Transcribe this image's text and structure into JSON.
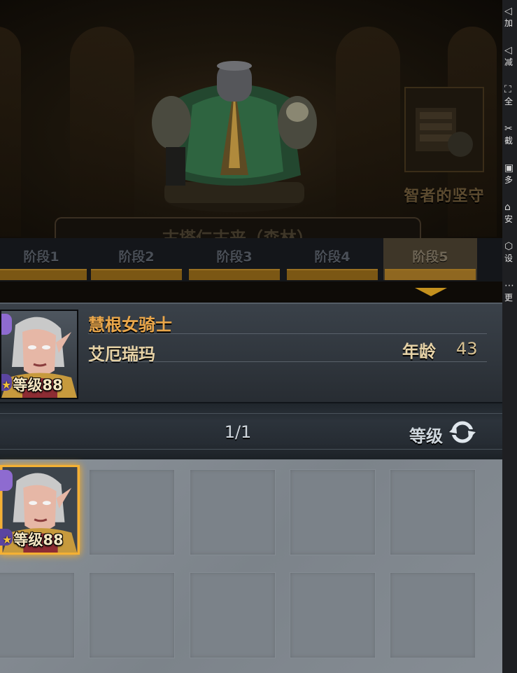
{
  "scene": {
    "reward_label": "智者的坚守",
    "quest_title": "古塔仁古来（森林）"
  },
  "stages": [
    {
      "label": "阶段1"
    },
    {
      "label": "阶段2"
    },
    {
      "label": "阶段3"
    },
    {
      "label": "阶段4"
    },
    {
      "label": "阶段5",
      "active": true
    }
  ],
  "hero": {
    "class_name": "慧根女骑士",
    "name": "艾厄瑞玛",
    "age_label": "年龄",
    "age": "43",
    "level": "等级88"
  },
  "sort": {
    "page": "1/1",
    "sort_label": "等级"
  },
  "roster": [
    {
      "level": "等级88",
      "selected": true
    }
  ],
  "toolbar": {
    "items": [
      {
        "icon": "volume-up-icon",
        "label": "加"
      },
      {
        "icon": "volume-down-icon",
        "label": "减"
      },
      {
        "icon": "fullscreen-icon",
        "label": "全"
      },
      {
        "icon": "scissors-icon",
        "label": "截"
      },
      {
        "icon": "multi-window-icon",
        "label": "多"
      },
      {
        "icon": "install-icon",
        "label": "安"
      },
      {
        "icon": "settings-icon",
        "label": "设"
      },
      {
        "icon": "more-icon",
        "label": "更"
      }
    ]
  }
}
